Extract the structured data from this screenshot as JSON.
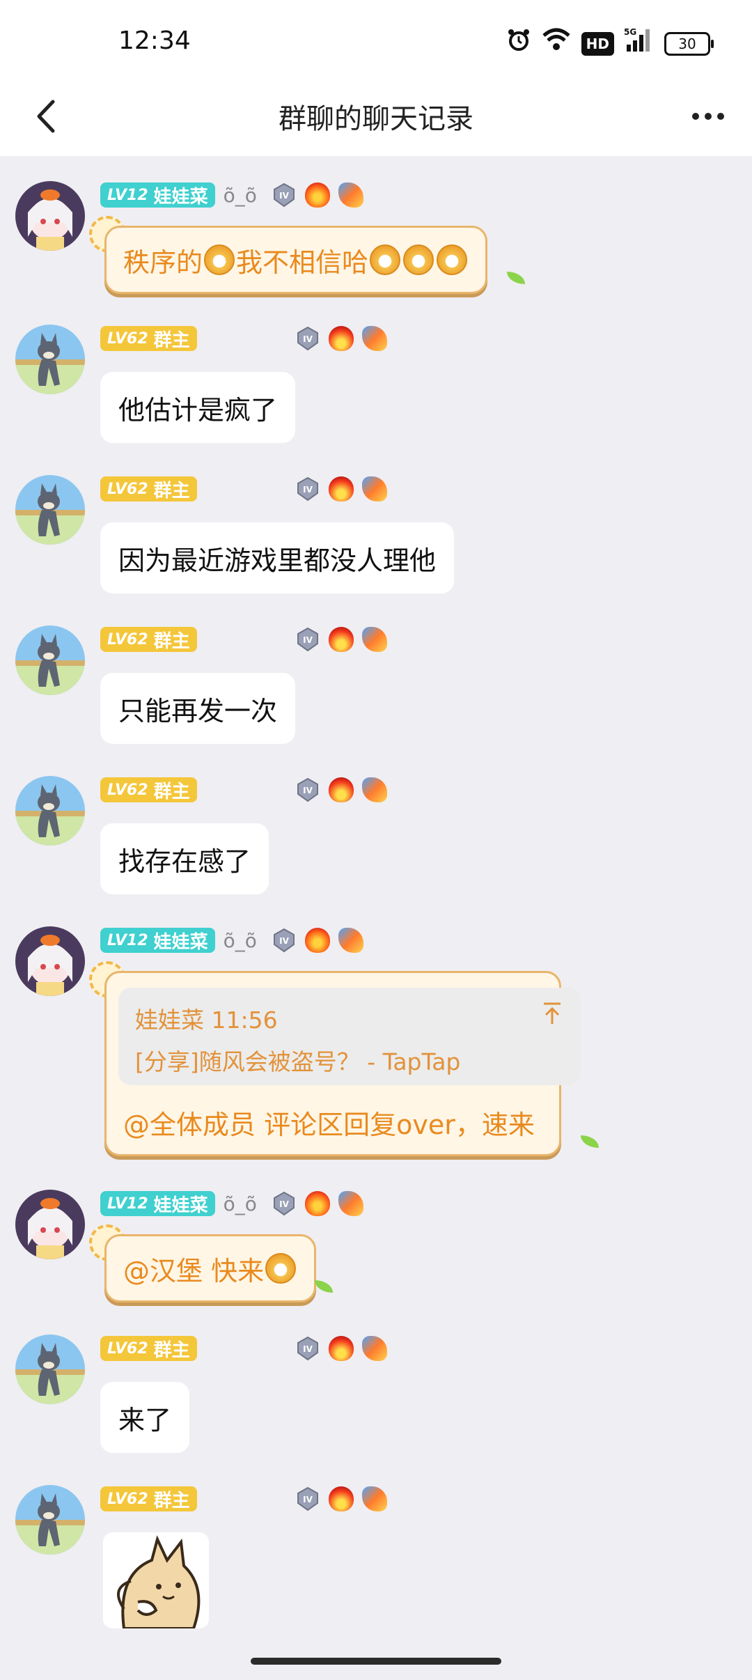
{
  "status_bar": {
    "time": "12:34",
    "battery": "30",
    "icons": [
      "alarm-icon",
      "wifi-icon",
      "hd-icon",
      "signal-5g-icon",
      "battery-icon"
    ],
    "hd_label": "HD"
  },
  "nav": {
    "title": "群聊的聊天记录",
    "back_icon": "chevron-left-icon",
    "more_icon": "more-dots-icon"
  },
  "users": {
    "wawacai": {
      "level": "LV12",
      "name": "娃娃菜",
      "tag": "õ_õ"
    },
    "qunzhu": {
      "level": "LV62",
      "name": "群主"
    }
  },
  "messages": [
    {
      "sender": "wawacai",
      "text": "秩序的",
      "text2": " 我不相信哈"
    },
    {
      "sender": "qunzhu",
      "text": "他估计是疯了"
    },
    {
      "sender": "qunzhu",
      "text": "因为最近游戏里都没人理他"
    },
    {
      "sender": "qunzhu",
      "text": "只能再发一次"
    },
    {
      "sender": "qunzhu",
      "text": "找存在感了"
    },
    {
      "sender": "wawacai",
      "quote_name": "娃娃菜 11:56",
      "quote_text": "[分享]随风会被盗号？ - TapTap",
      "text": "@全体成员 评论区回复over，速来"
    },
    {
      "sender": "wawacai",
      "text": "@汉堡 快来"
    },
    {
      "sender": "qunzhu",
      "text": "来了"
    },
    {
      "sender": "qunzhu",
      "sticker": "shiba-sticker"
    }
  ],
  "colors": {
    "bg": "#efeef2",
    "teal_badge": "#3fd0cf",
    "gold_badge": "#f4c63a",
    "deco_text": "#e98a1e"
  }
}
